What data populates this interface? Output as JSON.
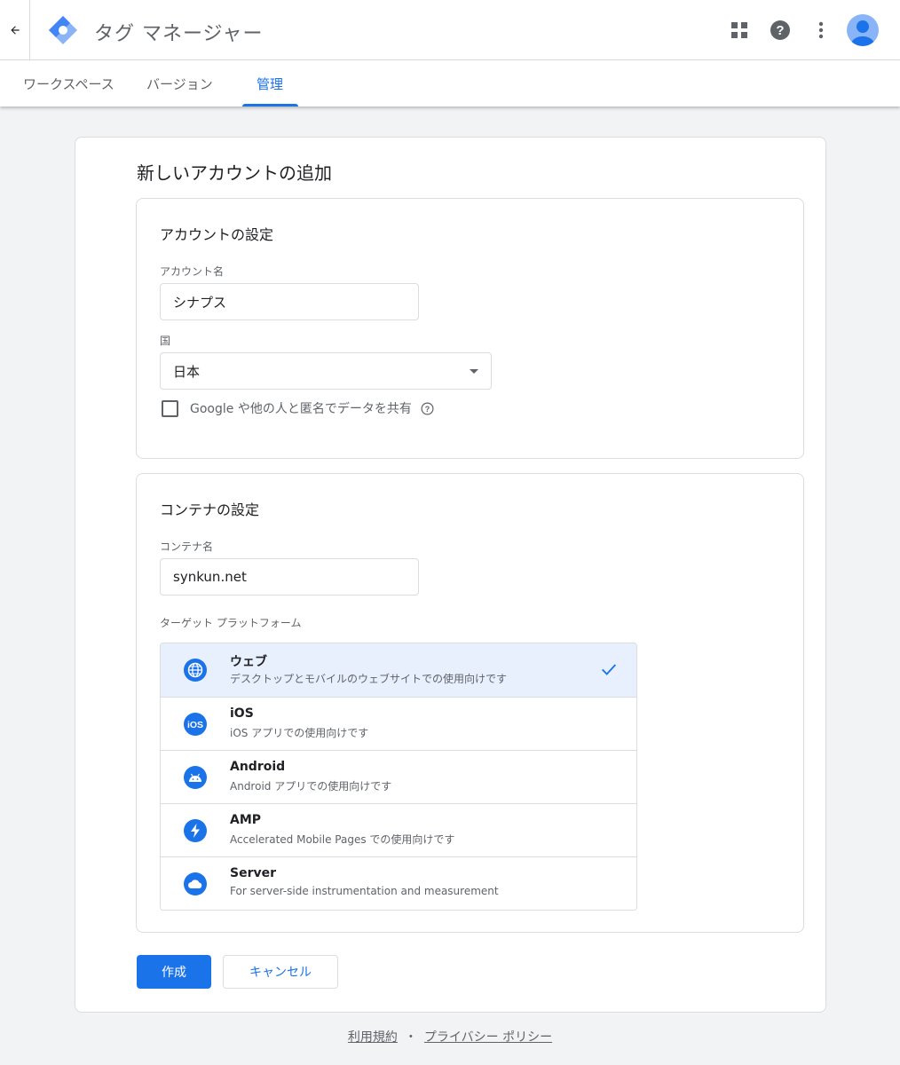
{
  "header": {
    "back_icon": "arrow-back-icon",
    "title": "タグ マネージャー",
    "icons": [
      "apps-grid-icon",
      "help-icon",
      "more-vert-icon",
      "account-avatar"
    ]
  },
  "tabs": [
    {
      "label": "ワークスペース",
      "active": false
    },
    {
      "label": "バージョン",
      "active": false
    },
    {
      "label": "管理",
      "active": true
    }
  ],
  "page": {
    "title": "新しいアカウントの追加"
  },
  "account_settings": {
    "title": "アカウントの設定",
    "account_name_label": "アカウント名",
    "account_name_value": "シナプス",
    "country_label": "国",
    "country_value": "日本",
    "share_checkbox_label": "Google や他の人と匿名でデータを共有",
    "share_checked": false
  },
  "container_settings": {
    "title": "コンテナの設定",
    "container_name_label": "コンテナ名",
    "container_name_value": "synkun.net",
    "platform_label": "ターゲット プラットフォーム",
    "platforms": [
      {
        "name": "ウェブ",
        "desc": "デスクトップとモバイルのウェブサイトでの使用向けです",
        "icon": "globe-icon",
        "selected": true
      },
      {
        "name": "iOS",
        "desc": "iOS アプリでの使用向けです",
        "icon": "ios-icon",
        "selected": false
      },
      {
        "name": "Android",
        "desc": "Android アプリでの使用向けです",
        "icon": "android-icon",
        "selected": false
      },
      {
        "name": "AMP",
        "desc": "Accelerated Mobile Pages での使用向けです",
        "icon": "amp-bolt-icon",
        "selected": false
      },
      {
        "name": "Server",
        "desc": "For server-side instrumentation and measurement",
        "icon": "cloud-icon",
        "selected": false
      }
    ]
  },
  "actions": {
    "create_label": "作成",
    "cancel_label": "キャンセル"
  },
  "footer": {
    "terms": "利用規約",
    "separator": "・",
    "privacy": "プライバシー ポリシー"
  },
  "colors": {
    "accent": "#1a73e8",
    "selected_bg": "#e8f0fe",
    "page_bg": "#f1f3f4"
  }
}
